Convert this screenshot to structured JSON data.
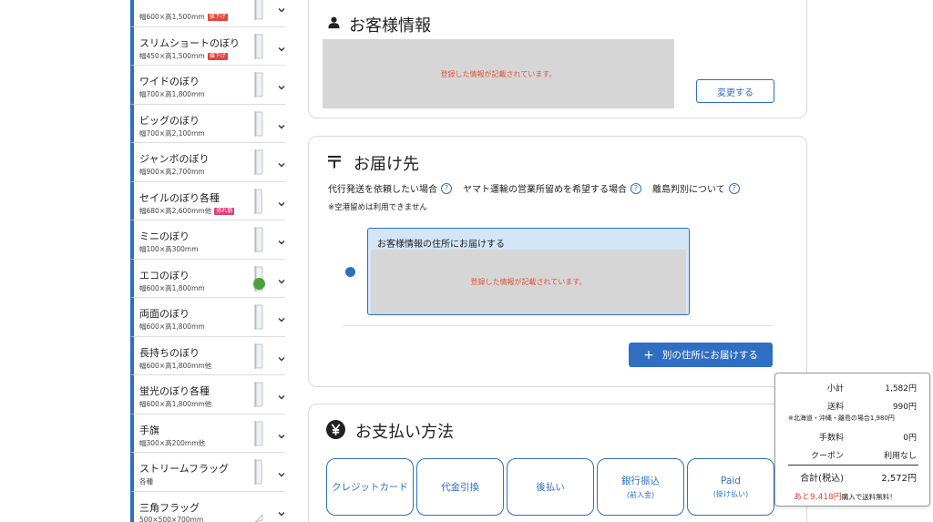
{
  "sidebar": {
    "items": [
      {
        "name": "",
        "size": "幅600×高1,500mm",
        "tag": "値下げ",
        "tag_color": "red"
      },
      {
        "name": "スリムショートのぼり",
        "size": "幅450×高1,500mm",
        "tag": "値下げ",
        "tag_color": "red"
      },
      {
        "name": "ワイドのぼり",
        "size": "幅700×高1,800mm",
        "tag": "",
        "tag_color": ""
      },
      {
        "name": "ビッグのぼり",
        "size": "幅700×高2,100mm",
        "tag": "",
        "tag_color": ""
      },
      {
        "name": "ジャンボのぼり",
        "size": "幅900×高2,700mm",
        "tag": "",
        "tag_color": ""
      },
      {
        "name": "セイルのぼり各種",
        "size": "幅680×高2,600mm他",
        "tag": "売れ筋",
        "tag_color": "pink"
      },
      {
        "name": "ミニのぼり",
        "size": "幅100×高300mm",
        "tag": "",
        "tag_color": ""
      },
      {
        "name": "エコのぼり",
        "size": "幅600×高1,800mm",
        "tag": "",
        "tag_color": ""
      },
      {
        "name": "両面のぼり",
        "size": "幅600×高1,800mm",
        "tag": "",
        "tag_color": ""
      },
      {
        "name": "長持ちのぼり",
        "size": "幅600×高1,800mm他",
        "tag": "",
        "tag_color": ""
      },
      {
        "name": "蛍光のぼり各種",
        "size": "幅600×高1,800mm他",
        "tag": "",
        "tag_color": ""
      },
      {
        "name": "手旗",
        "size": "幅300×高200mm他",
        "tag": "",
        "tag_color": ""
      },
      {
        "name": "ストリームフラッグ",
        "size": "各種",
        "tag": "",
        "tag_color": ""
      },
      {
        "name": "三角フラッグ",
        "size": "500×500×700mm",
        "tag": "",
        "tag_color": ""
      }
    ]
  },
  "customer": {
    "title": "お客様情報",
    "registered_text": "登録した情報が記載されています。",
    "change_button": "変更する"
  },
  "delivery": {
    "title": "お届け先",
    "links": [
      "代行発送を依頼したい場合",
      "ヤマト運輸の営業所留めを希望する場合",
      "離島判別について"
    ],
    "note": "※空港留めは利用できません",
    "option_title": "お客様情報の住所にお届けする",
    "registered_text": "登録した情報が記載されています。",
    "other_address_button": "別の住所にお届けする"
  },
  "payment": {
    "title": "お支払い方法",
    "methods": [
      {
        "label": "クレジットカード",
        "sub": ""
      },
      {
        "label": "代金引換",
        "sub": ""
      },
      {
        "label": "後払い",
        "sub": ""
      },
      {
        "label": "銀行振込",
        "sub": "(前入金)"
      },
      {
        "label": "Paid",
        "sub": "(掛け払い)"
      }
    ]
  },
  "summary": {
    "subtotal_label": "小計",
    "subtotal": "1,582円",
    "shipping_label": "送料",
    "shipping": "990円",
    "shipping_note": "※北海道・沖縄・離島の場合1,980円",
    "fee_label": "手数料",
    "fee": "0円",
    "coupon_label": "クーポン",
    "coupon": "利用なし",
    "total_label": "合計(税込)",
    "total": "2,572円",
    "remain_prefix": "あと9,418円",
    "remain_suffix": "購入で送料無料！"
  },
  "colors": {
    "accent": "#2e6fc4",
    "alert": "#e0453a",
    "tag_pink": "#e53d7a",
    "eco_green": "#4aa33a"
  }
}
